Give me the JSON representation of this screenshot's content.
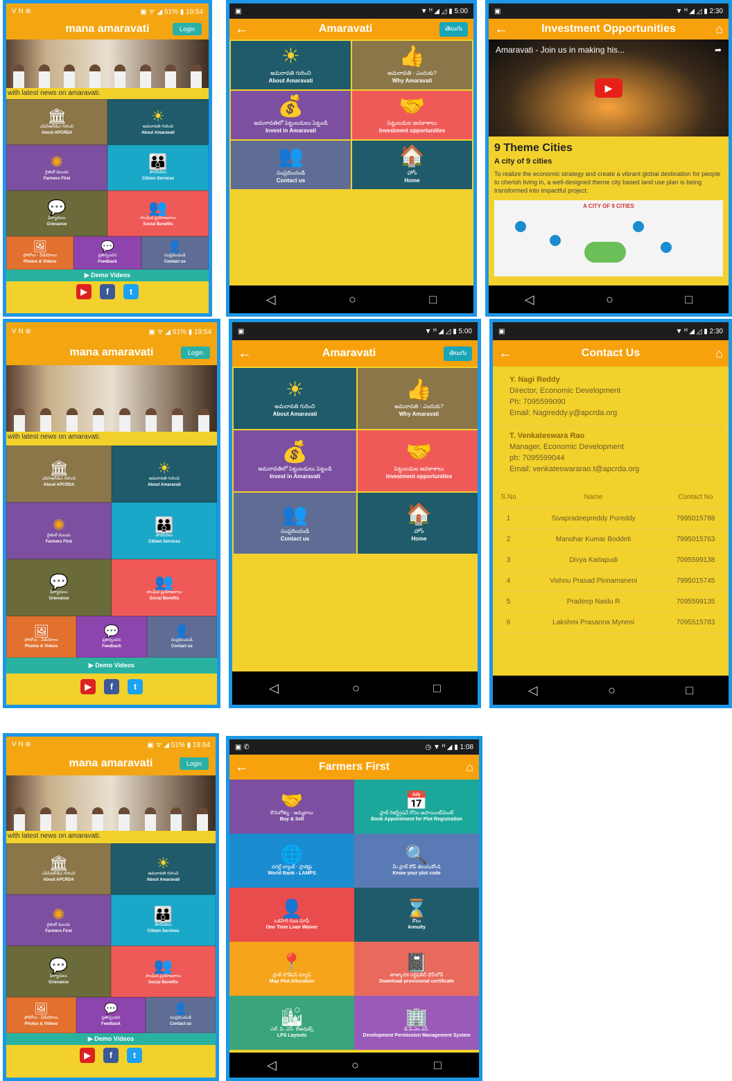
{
  "home": {
    "status_left": "V N ⊕",
    "status_right": "▣ ᯤ ◢ 51% ▮ 19:54",
    "title": "mana amaravati",
    "login": "Login",
    "ticker": "with latest news on amaravati.",
    "tiles": [
      {
        "te": "ఎపిసిఆర్‌డిఎ గురించి",
        "en": "About APCRDA",
        "icon": "🏛",
        "color": "#8a7649"
      },
      {
        "te": "అమరావతి గురించి",
        "en": "About Amaravati",
        "icon": "☀",
        "color": "#1f5b6a"
      },
      {
        "te": "రైతులే ముందు",
        "en": "Farmers First",
        "icon": "✺",
        "color": "#7c4fa0"
      },
      {
        "te": "పౌరసేవలు",
        "en": "Citizen Services",
        "icon": "👪",
        "color": "#1ba8c8"
      },
      {
        "te": "ఫిర్యాదులు",
        "en": "Grievance",
        "icon": "💬",
        "color": "#6a6a3a"
      },
      {
        "te": "సాంఘిక ప్రయోజనాలు",
        "en": "Social Benefits",
        "icon": "👥",
        "color": "#ef5a58"
      }
    ],
    "row3": [
      {
        "te": "ఫోటోలు - వీడియోలు",
        "en": "Photos & Videos",
        "icon": "🖼",
        "color": "#e2702f"
      },
      {
        "te": "ప్రతిస్పందన",
        "en": "Feedback",
        "icon": "💬",
        "color": "#8e44ad"
      },
      {
        "te": "సంప్రదించండి",
        "en": "Contact us",
        "icon": "👤",
        "color": "#5f6d95"
      }
    ],
    "demo": "Demo Videos",
    "social": [
      "You Tube",
      "f",
      "t"
    ]
  },
  "amaravati": {
    "status_right": "▼ ᴴ ◢ ◿ ▮ 5:00",
    "title": "Amaravati",
    "lang": "తెలుగు",
    "tiles": [
      {
        "te": "అమరావతి గురించి",
        "en": "About Amaravati",
        "icon": "☀",
        "color": "#1f5b6a"
      },
      {
        "te": "అమరావతి - ఎందుకు?",
        "en": "Why Amaravati",
        "icon": "👍",
        "color": "#8a7649"
      },
      {
        "te": "అమరావతిలో పెట్టుబడులు పెట్టండి",
        "en": "Invest in Amaravati",
        "icon": "💰",
        "color": "#7c4fa0"
      },
      {
        "te": "పెట్టుబడుల అవకాశాలు",
        "en": "Investment opportunities",
        "icon": "🤝",
        "color": "#ef5a58"
      },
      {
        "te": "సంప్రదించండి",
        "en": "Contact us",
        "icon": "👥",
        "color": "#5f6d95"
      },
      {
        "te": "హోం",
        "en": "Home",
        "icon": "🏠",
        "color": "#1f5b6a"
      }
    ]
  },
  "investment": {
    "status_right": "▼ ᴴ ◢ ◿ ▮ 2:30",
    "title": "Investment Opportunities",
    "video_title": "Amaravati - Join us in making his...",
    "heading": "9 Theme Cities",
    "subheading": "A city of 9 cities",
    "body": "To realize the economic strategy and create a vibrant global destination for people to cherish living in, a well-designed theme city based land use plan is being transformed into impactful project.",
    "image_caption": "A CITY OF 9 CITIES"
  },
  "contact": {
    "status_right": "▼ ᴴ ◢ ◿ ▮ 2:30",
    "title": "Contact Us",
    "people": [
      {
        "name": "Y. Nagi Reddy",
        "role": "Director, Economic Development",
        "ph": "Ph: 7095599090",
        "email": "Email: Nagireddy.y@apcrda.org"
      },
      {
        "name": "T. Venkateswara Rao",
        "role": "Manager, Economic Development",
        "ph": "ph: 7095599044",
        "email": "Email: venkateswararao.t@apcrda.org"
      }
    ],
    "headers": [
      "S.No",
      "Name",
      "Contact No"
    ],
    "rows": [
      [
        "1",
        "Sivapradeepreddy Poreddy",
        "7995015788"
      ],
      [
        "2",
        "Manohar Kumar Boddeti",
        "7995015763"
      ],
      [
        "3",
        "Divya Karlapudi",
        "7095599138"
      ],
      [
        "4",
        "Vishnu Prasad Pinnamaneni",
        "7995015745"
      ],
      [
        "5",
        "Pradeep Naidu R",
        "7095599135"
      ],
      [
        "6",
        "Lakshmi Prasanna Myneni",
        "7095515783"
      ]
    ]
  },
  "farmers": {
    "status_right": "◷ ▼ ᴴ ◢ ▮ 1:08",
    "title": "Farmers First",
    "tiles": [
      {
        "te": "కొనుగోళ్ళు - అమ్మకాలు",
        "en": "Buy & Sell",
        "icon": "🤝",
        "color": "#7c4fa0"
      },
      {
        "te": "ప్లాట్ రిజిస్ట్రేషన్ కోసం అపాయింట్‌మెంట్",
        "en": "Book Appointment for Plot Registration",
        "icon": "📅",
        "color": "#1ba89a"
      },
      {
        "te": "వరల్డ్ బ్యాంక్ - ప్రాజెక్టు",
        "en": "World Bank - LAMPS",
        "icon": "🌐",
        "color": "#1a8ccf"
      },
      {
        "te": "మీ ప్లాట్ కోడ్ తెలుసుకోండి",
        "en": "Know your plot code",
        "icon": "🔍",
        "color": "#5a7ab5"
      },
      {
        "te": "ఒకసారి రుణ మాఫీ",
        "en": "One Time Loan Waiver",
        "icon": "👤",
        "color": "#e94c4c"
      },
      {
        "te": "కౌలు",
        "en": "Annuity",
        "icon": "⌛",
        "color": "#1f5b6a"
      },
      {
        "te": "ప్లాట్ లొకేషన్ మ్యాప్",
        "en": "Map Plot Allocation",
        "icon": "📍",
        "color": "#f5a31a"
      },
      {
        "te": "తాత్కాలిక సర్టిఫికేట్ డౌన్‌లోడ్",
        "en": "Download provisional certificate",
        "icon": "📓",
        "color": "#e86a5c"
      },
      {
        "te": "ఎల్. పి. ఎస్. లేఅవుట్స్",
        "en": "LPS Layouts",
        "icon": "🏙",
        "color": "#3aa57a"
      },
      {
        "te": "డి.పి.ఎం.ఎస్.",
        "en": "Development Permission Management System",
        "icon": "🏢",
        "color": "#9a5ab8"
      }
    ]
  },
  "nav": [
    "◁",
    "○",
    "□"
  ]
}
